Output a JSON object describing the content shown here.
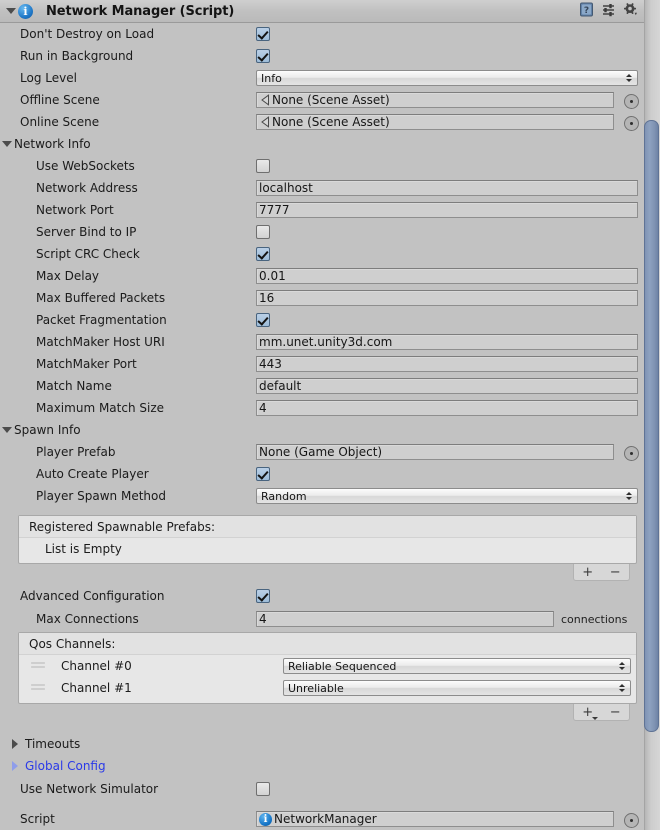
{
  "component": {
    "title": "Network Manager (Script)",
    "info_icon": "info-badge-icon",
    "header_icons": [
      "help-book-icon",
      "preset-sliders-icon",
      "gear-icon"
    ]
  },
  "fields": {
    "dont_destroy_on_load": {
      "label": "Don't Destroy on Load",
      "value": true
    },
    "run_in_background": {
      "label": "Run in Background",
      "value": true
    },
    "log_level": {
      "label": "Log Level",
      "value": "Info"
    },
    "offline_scene": {
      "label": "Offline Scene",
      "value": "None (Scene Asset)"
    },
    "online_scene": {
      "label": "Online Scene",
      "value": "None (Scene Asset)"
    }
  },
  "network_info": {
    "title": "Network Info",
    "expanded": true,
    "use_websockets": {
      "label": "Use WebSockets",
      "value": false
    },
    "network_address": {
      "label": "Network Address",
      "value": "localhost"
    },
    "network_port": {
      "label": "Network Port",
      "value": "7777"
    },
    "server_bind_to_ip": {
      "label": "Server Bind to IP",
      "value": false
    },
    "script_crc_check": {
      "label": "Script CRC Check",
      "value": true
    },
    "max_delay": {
      "label": "Max Delay",
      "value": "0.01"
    },
    "max_buffered_packets": {
      "label": "Max Buffered Packets",
      "value": "16"
    },
    "packet_fragmentation": {
      "label": "Packet Fragmentation",
      "value": true
    },
    "matchmaker_host_uri": {
      "label": "MatchMaker Host URI",
      "value": "mm.unet.unity3d.com"
    },
    "matchmaker_port": {
      "label": "MatchMaker Port",
      "value": "443"
    },
    "match_name": {
      "label": "Match Name",
      "value": "default"
    },
    "maximum_match_size": {
      "label": "Maximum Match Size",
      "value": "4"
    }
  },
  "spawn_info": {
    "title": "Spawn Info",
    "expanded": true,
    "player_prefab": {
      "label": "Player Prefab",
      "value": "None (Game Object)"
    },
    "auto_create_player": {
      "label": "Auto Create Player",
      "value": true
    },
    "player_spawn_method": {
      "label": "Player Spawn Method",
      "value": "Random"
    },
    "spawnable_prefabs": {
      "header": "Registered Spawnable Prefabs:",
      "empty_text": "List is Empty",
      "items": [],
      "add_label": "+",
      "remove_label": "−"
    }
  },
  "advanced": {
    "advanced_configuration": {
      "label": "Advanced Configuration",
      "value": true
    },
    "max_connections": {
      "label": "Max Connections",
      "value": "4",
      "suffix": "connections"
    },
    "qos_channels": {
      "header": "Qos Channels:",
      "rows": [
        {
          "label": "Channel #0",
          "value": "Reliable Sequenced"
        },
        {
          "label": "Channel #1",
          "value": "Unreliable"
        }
      ],
      "add_label": "+",
      "remove_label": "−"
    }
  },
  "footer": {
    "timeouts": {
      "label": "Timeouts",
      "expanded": false
    },
    "global_config": {
      "label": "Global Config",
      "expanded": false,
      "color": "#2b3ae8"
    },
    "use_network_simulator": {
      "label": "Use Network Simulator",
      "value": false
    },
    "script": {
      "label": "Script",
      "value": "NetworkManager"
    }
  },
  "colors": {
    "background": "#c2c2c2",
    "field_bg": "#cfcfcf",
    "checkbox_on": "#9dbcd8",
    "link_blue": "#2b3ae8",
    "scrollbar_thumb": "#7f93b4"
  }
}
